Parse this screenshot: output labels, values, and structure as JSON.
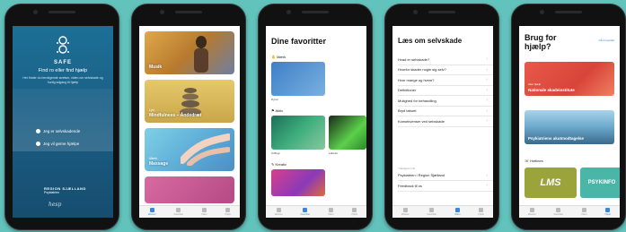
{
  "phone1": {
    "app_name": "SAFE",
    "tagline": "Find ro eller find hjælp",
    "description": "Her finder du beroligende øvelser, viden om selvskade og hurtig adgang til hjælp",
    "buttons": [
      "Jeg er selvskadende",
      "Jeg vil gerne hjælpe"
    ],
    "region_title": "REGION SJÆLLAND",
    "region_sub": "Psykiatrien",
    "signature": "hesp"
  },
  "phone2": {
    "tiles": [
      {
        "label": "Musik",
        "tag": ""
      },
      {
        "label": "Mindfulness – Åndedræt",
        "tag": "Lyd"
      },
      {
        "label": "Massage",
        "tag": "Mærk"
      },
      {
        "label": "",
        "tag": ""
      }
    ]
  },
  "phone3": {
    "title": "Dine favoritter",
    "sections": [
      "Mærk",
      "Aktiv",
      "Kreativ"
    ],
    "items": [
      "Dyner",
      "Udflugt",
      "Løbetur"
    ]
  },
  "phone4": {
    "title": "Læs om selvskade",
    "items": [
      "Hvad er selvskade?",
      "Hvorfor skader nogle sig selv?",
      "Hvor mange og hvem?",
      "Definitioner",
      "Mulighed for behandling",
      "Bryd tabuet",
      "Konsekvenser ved selvskade"
    ],
    "section_header": "Yderligere info",
    "more_items": [
      "Psykiatrien i Region Sjælland",
      "Feedback til os"
    ]
  },
  "phone5": {
    "title": "Brug for hjælp?",
    "link": "Gå til kontakt",
    "cards": [
      {
        "tag": "Akut hjælp",
        "label": "Nationale skadeinstitute"
      },
      {
        "tag": "",
        "label": "Psykiatriens akutmodtagelse"
      }
    ],
    "section": "Hotlines",
    "hotlines": [
      "LMS",
      "PSYKINFO"
    ]
  },
  "tabs": [
    "Øvelser",
    "Favoritter",
    "Viden",
    "Hjælp"
  ]
}
